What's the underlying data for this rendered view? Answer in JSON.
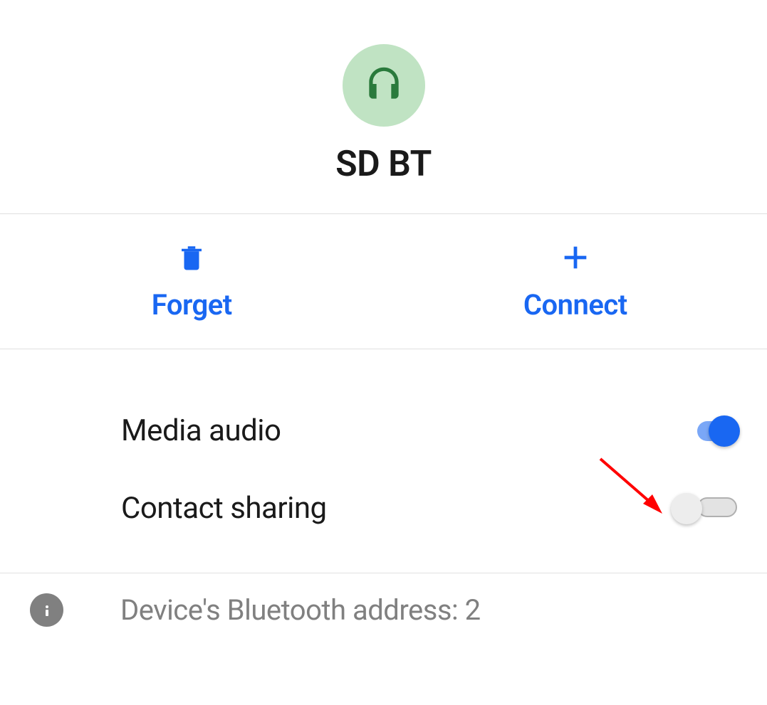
{
  "header": {
    "device_name": "SD BT"
  },
  "actions": {
    "forget_label": "Forget",
    "connect_label": "Connect"
  },
  "settings": {
    "media_audio": {
      "label": "Media audio",
      "enabled": true
    },
    "contact_sharing": {
      "label": "Contact sharing",
      "enabled": false
    }
  },
  "footer": {
    "bluetooth_address_label": "Device's Bluetooth address: 2"
  },
  "colors": {
    "accent": "#1967f2",
    "icon_bg": "#c0e3c3",
    "icon_fg": "#2a7a3c"
  }
}
